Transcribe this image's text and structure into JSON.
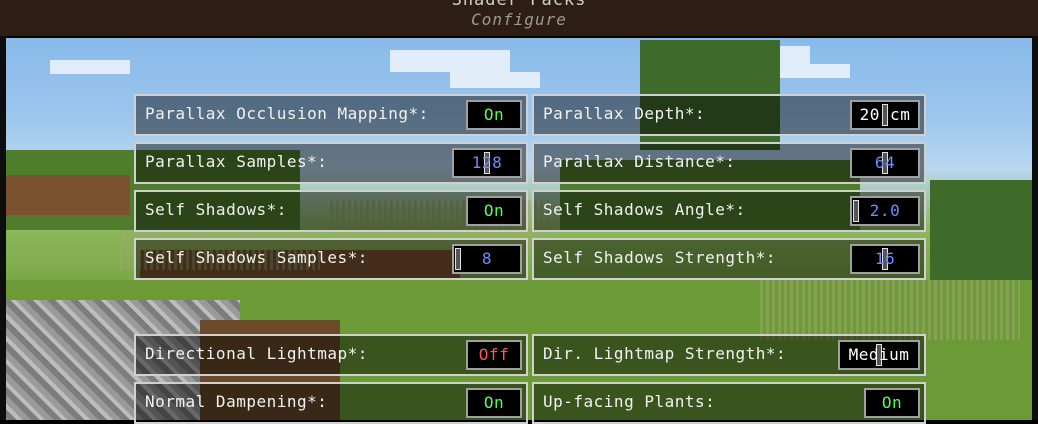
{
  "header": {
    "title": "Shader Packs",
    "subtitle": "Configure"
  },
  "colors": {
    "on": "#55ff55",
    "off": "#ff5555",
    "slider_value": "#6f8bff",
    "white_value": "#ffffff"
  },
  "options": [
    {
      "label": "Parallax Occlusion Mapping*:",
      "value": "On",
      "kind": "toggle",
      "state": "on"
    },
    {
      "label": "Parallax Depth*:",
      "value": "20 cm",
      "kind": "slider",
      "level": 0.5
    },
    {
      "label": "Parallax Samples*:",
      "value": "128",
      "kind": "slider",
      "level": 0.5
    },
    {
      "label": "Parallax Distance*:",
      "value": "64",
      "kind": "slider",
      "level": 0.5
    },
    {
      "label": "Self Shadows*:",
      "value": "On",
      "kind": "toggle",
      "state": "on"
    },
    {
      "label": "Self Shadows Angle*:",
      "value": "2.0",
      "kind": "slider",
      "level": 0
    },
    {
      "label": "Self Shadows Samples*:",
      "value": "8",
      "kind": "slider",
      "level": 0
    },
    {
      "label": "Self Shadows Strength*:",
      "value": "16",
      "kind": "slider",
      "level": 0.5
    },
    {
      "label": "Directional Lightmap*:",
      "value": "Off",
      "kind": "toggle",
      "state": "off"
    },
    {
      "label": "Dir. Lightmap Strength*:",
      "value": "Medium",
      "kind": "slider",
      "level": 0.5
    },
    {
      "label": "Normal Dampening*:",
      "value": "On",
      "kind": "toggle",
      "state": "on"
    },
    {
      "label": "Up-facing Plants:",
      "value": "On",
      "kind": "toggle",
      "state": "on"
    }
  ]
}
